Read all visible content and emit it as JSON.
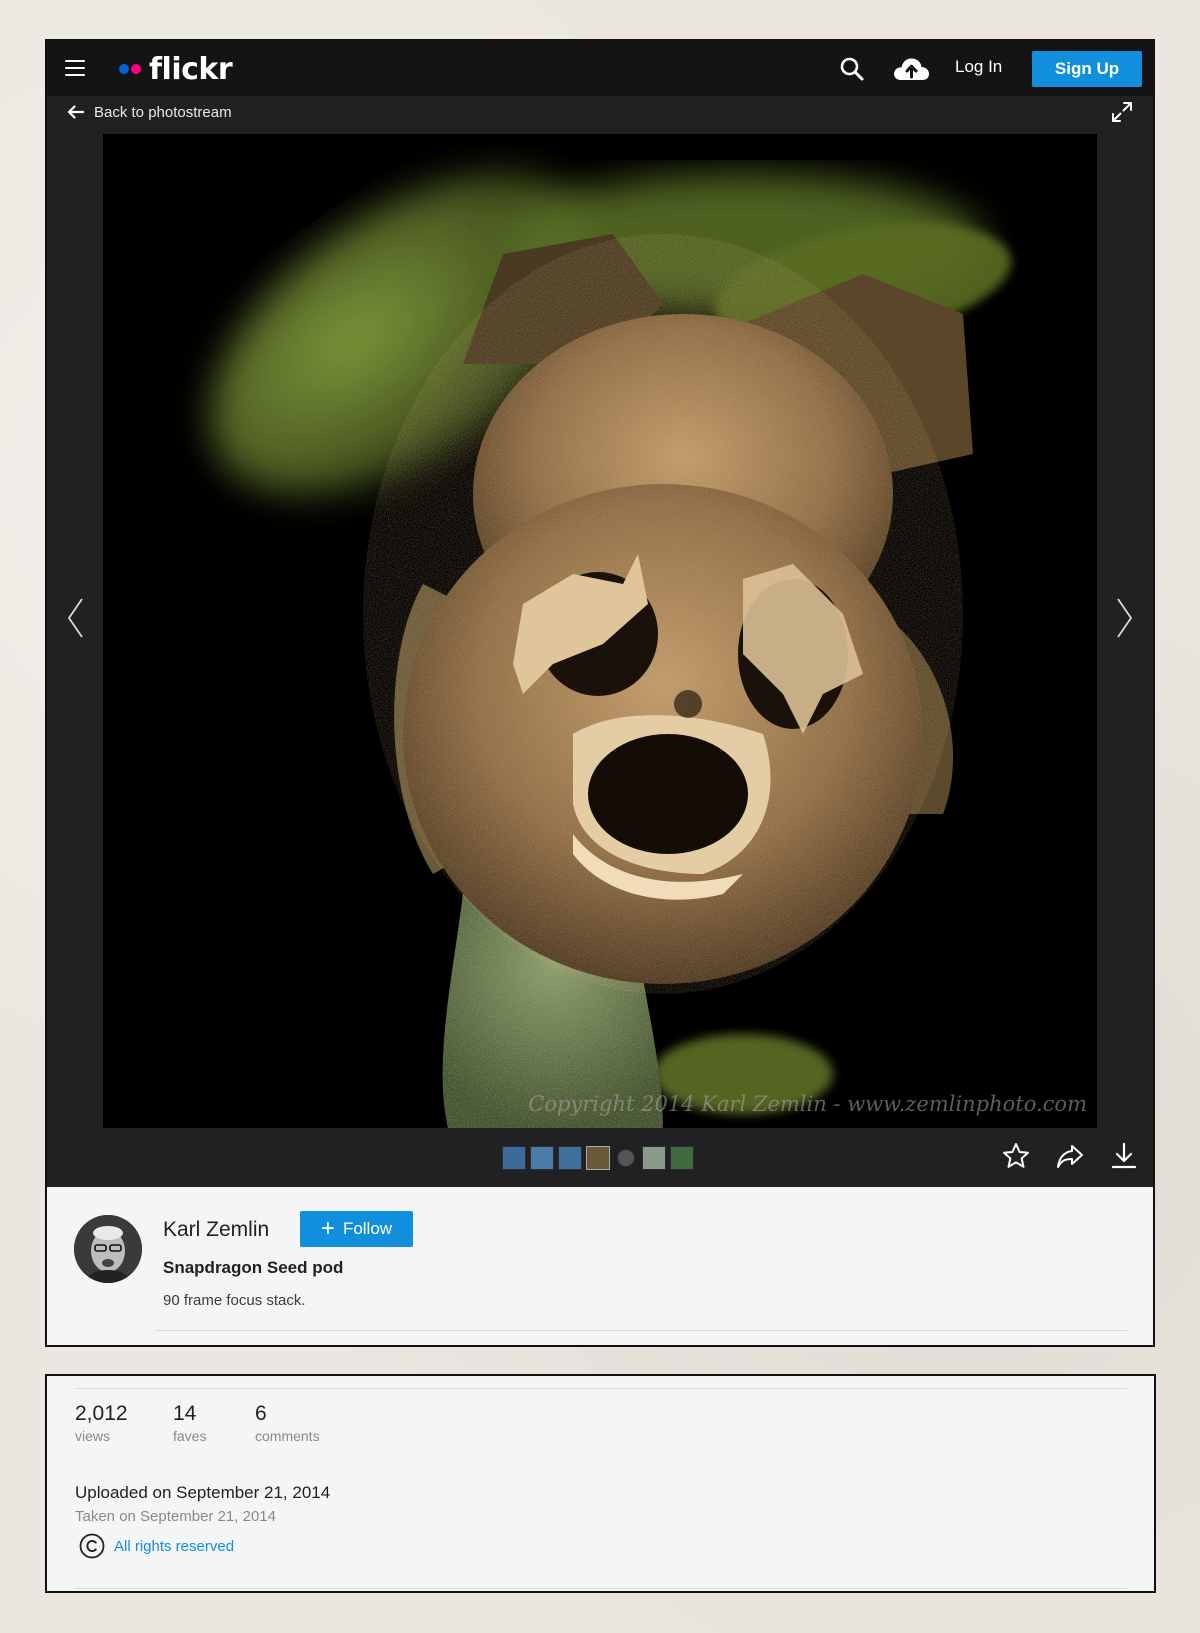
{
  "nav": {
    "logo_text": "flickr",
    "login_label": "Log In",
    "signup_label": "Sign Up",
    "icons": [
      "menu-icon",
      "search-icon",
      "upload-cloud-icon"
    ]
  },
  "viewer": {
    "back_label": "Back to photostream",
    "watermark": "Copyright 2014 Karl Zemlin - www.zemlinphoto.com",
    "icons": [
      "arrow-left-icon",
      "expand-icon",
      "chevron-left-icon",
      "chevron-right-icon",
      "star-icon",
      "share-icon",
      "download-icon"
    ]
  },
  "filmstrip": {
    "thumb_colors": [
      "#3c6a9a",
      "#4a7aa8",
      "#3f6f9c",
      "#6a5a3a",
      "#555555",
      "#8a9a8a",
      "#3f6a3f"
    ]
  },
  "owner": {
    "name": "Karl Zemlin",
    "follow_label": "Follow"
  },
  "photo": {
    "title": "Snapdragon Seed pod",
    "description": "90 frame focus stack."
  },
  "stats": {
    "views": {
      "value": "2,012",
      "label": "views"
    },
    "faves": {
      "value": "14",
      "label": "faves"
    },
    "comments": {
      "value": "6",
      "label": "comments"
    }
  },
  "dates": {
    "uploaded": "Uploaded on September 21, 2014",
    "taken": "Taken on September 21, 2014"
  },
  "license": {
    "label": "All rights reserved",
    "icon": "copyright-icon"
  },
  "colors": {
    "accent": "#128fdc",
    "nav_bg": "#141416",
    "viewer_bg": "#212124",
    "info_bg": "#f3f5f6"
  }
}
